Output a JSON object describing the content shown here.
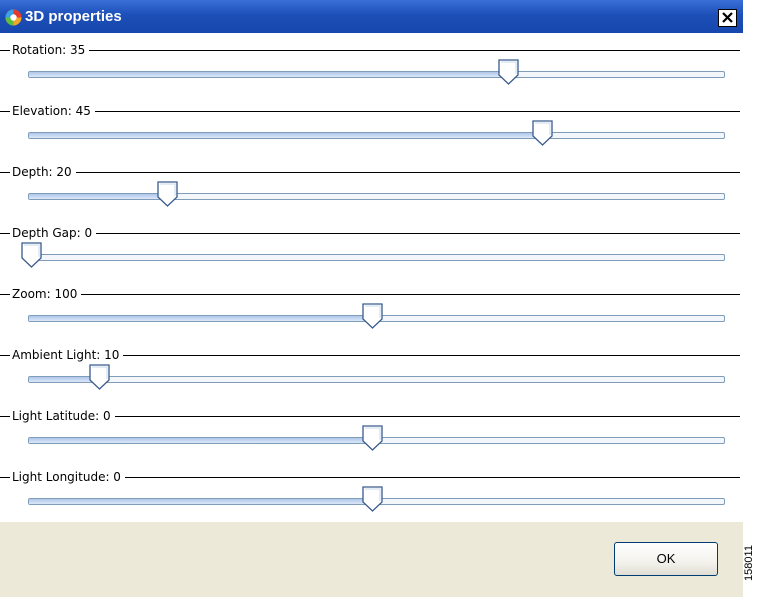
{
  "window": {
    "title": "3D properties",
    "icon": "3d-cube-icon",
    "close_label": "close-icon"
  },
  "sliders": [
    {
      "label": "Rotation: 35",
      "fraction": 0.7
    },
    {
      "label": "Elevation: 45",
      "fraction": 0.75
    },
    {
      "label": "Depth: 20",
      "fraction": 0.2
    },
    {
      "label": "Depth Gap: 0",
      "fraction": 0.0
    },
    {
      "label": "Zoom: 100",
      "fraction": 0.5
    },
    {
      "label": "Ambient Light: 10",
      "fraction": 0.1
    },
    {
      "label": "Light Latitude: 0",
      "fraction": 0.5
    },
    {
      "label": "Light Longitude: 0",
      "fraction": 0.5
    }
  ],
  "footer": {
    "ok_label": "OK"
  },
  "figure_id": "158011",
  "colors": {
    "titlebar": "#1d4fb8",
    "track_fill": "#aec7ea",
    "track_border": "#7f9db9",
    "footer_bg": "#ece9d8"
  }
}
